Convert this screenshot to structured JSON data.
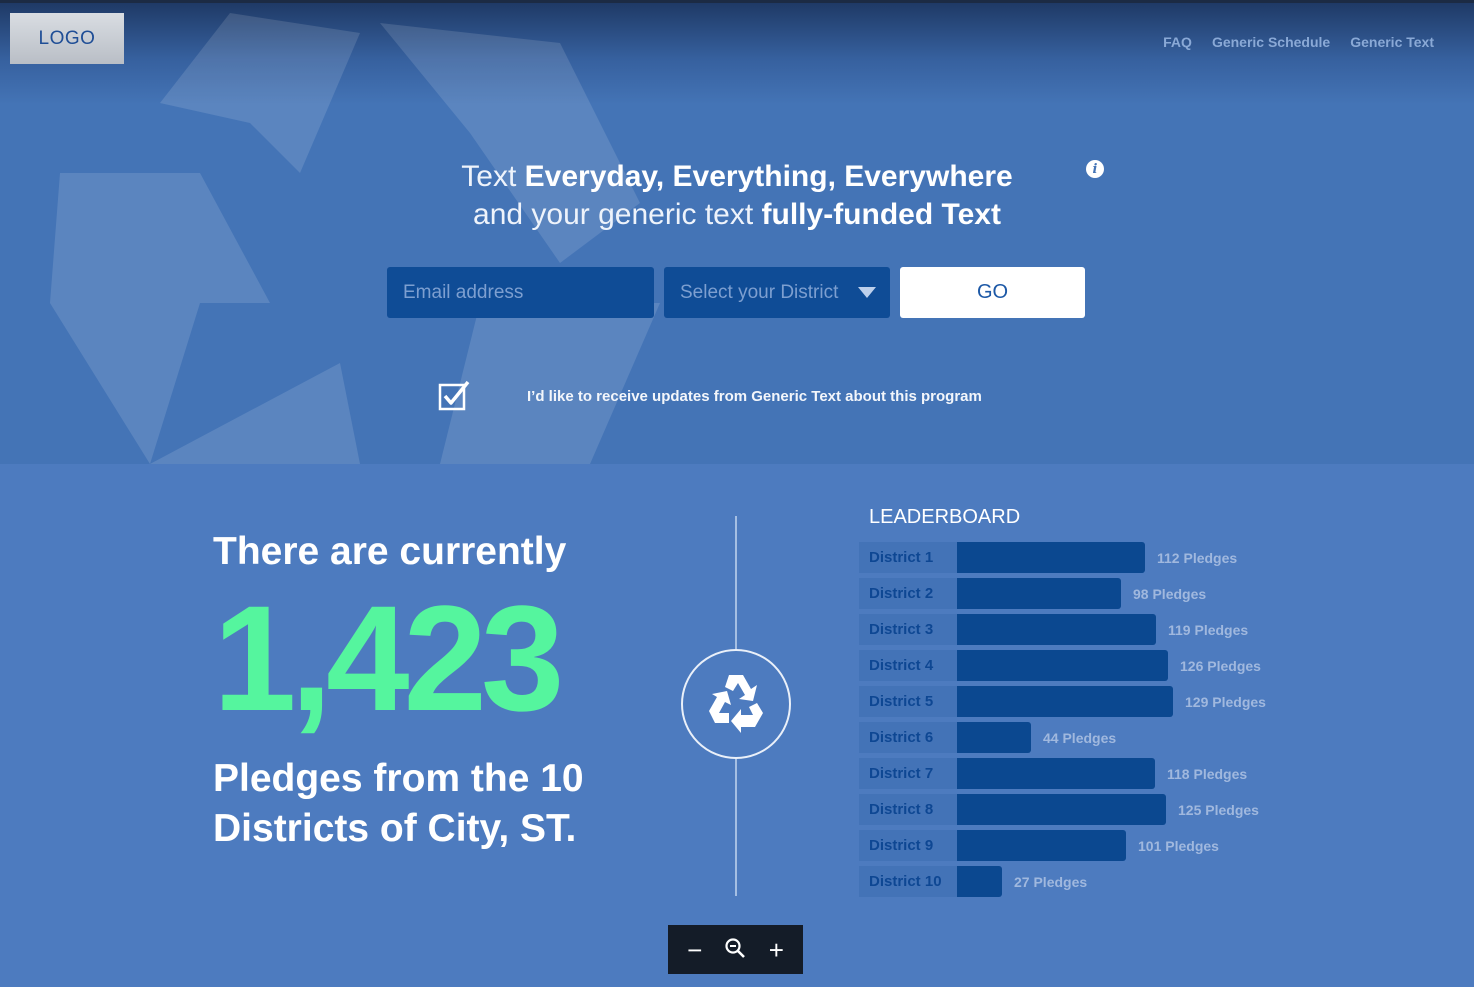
{
  "header": {
    "logo_text": "LOGO",
    "nav": [
      "FAQ",
      "Generic Schedule",
      "Generic Text"
    ]
  },
  "hero": {
    "line1_light": "Text ",
    "line1_bold": "Everyday, Everything, Everywhere",
    "line2_light": "and your generic text ",
    "line2_bold": "fully-funded Text",
    "email_placeholder": "Email address",
    "district_placeholder": "Select your District",
    "go_label": "GO",
    "checkbox_checked": true,
    "checkbox_label": "I’d like to receive updates from Generic Text about this program",
    "info_icon": "info-icon"
  },
  "stats": {
    "intro": "There are currently",
    "count": "1,423",
    "outro_line1": "Pledges from the 10",
    "outro_line2": "Districts of City, ST."
  },
  "leaderboard": {
    "title": "LEADERBOARD",
    "rows": [
      {
        "district": "District 1",
        "pledges": 112,
        "label": "112 Pledges"
      },
      {
        "district": "District 2",
        "pledges": 98,
        "label": "98 Pledges"
      },
      {
        "district": "District 3",
        "pledges": 119,
        "label": "119 Pledges"
      },
      {
        "district": "District 4",
        "pledges": 126,
        "label": "126 Pledges"
      },
      {
        "district": "District 5",
        "pledges": 129,
        "label": "129 Pledges"
      },
      {
        "district": "District 6",
        "pledges": 44,
        "label": "44 Pledges"
      },
      {
        "district": "District 7",
        "pledges": 118,
        "label": "118 Pledges"
      },
      {
        "district": "District 8",
        "pledges": 125,
        "label": "125 Pledges"
      },
      {
        "district": "District 9",
        "pledges": 101,
        "label": "101 Pledges"
      },
      {
        "district": "District 10",
        "pledges": 27,
        "label": "27 Pledges"
      }
    ]
  },
  "zoom_controls": [
    "zoom-out-icon",
    "zoom-reset-icon",
    "zoom-in-icon"
  ],
  "colors": {
    "accent_green": "#55f59e",
    "bar_blue": "#0b4890",
    "background_blue": "#4d7bbf"
  }
}
